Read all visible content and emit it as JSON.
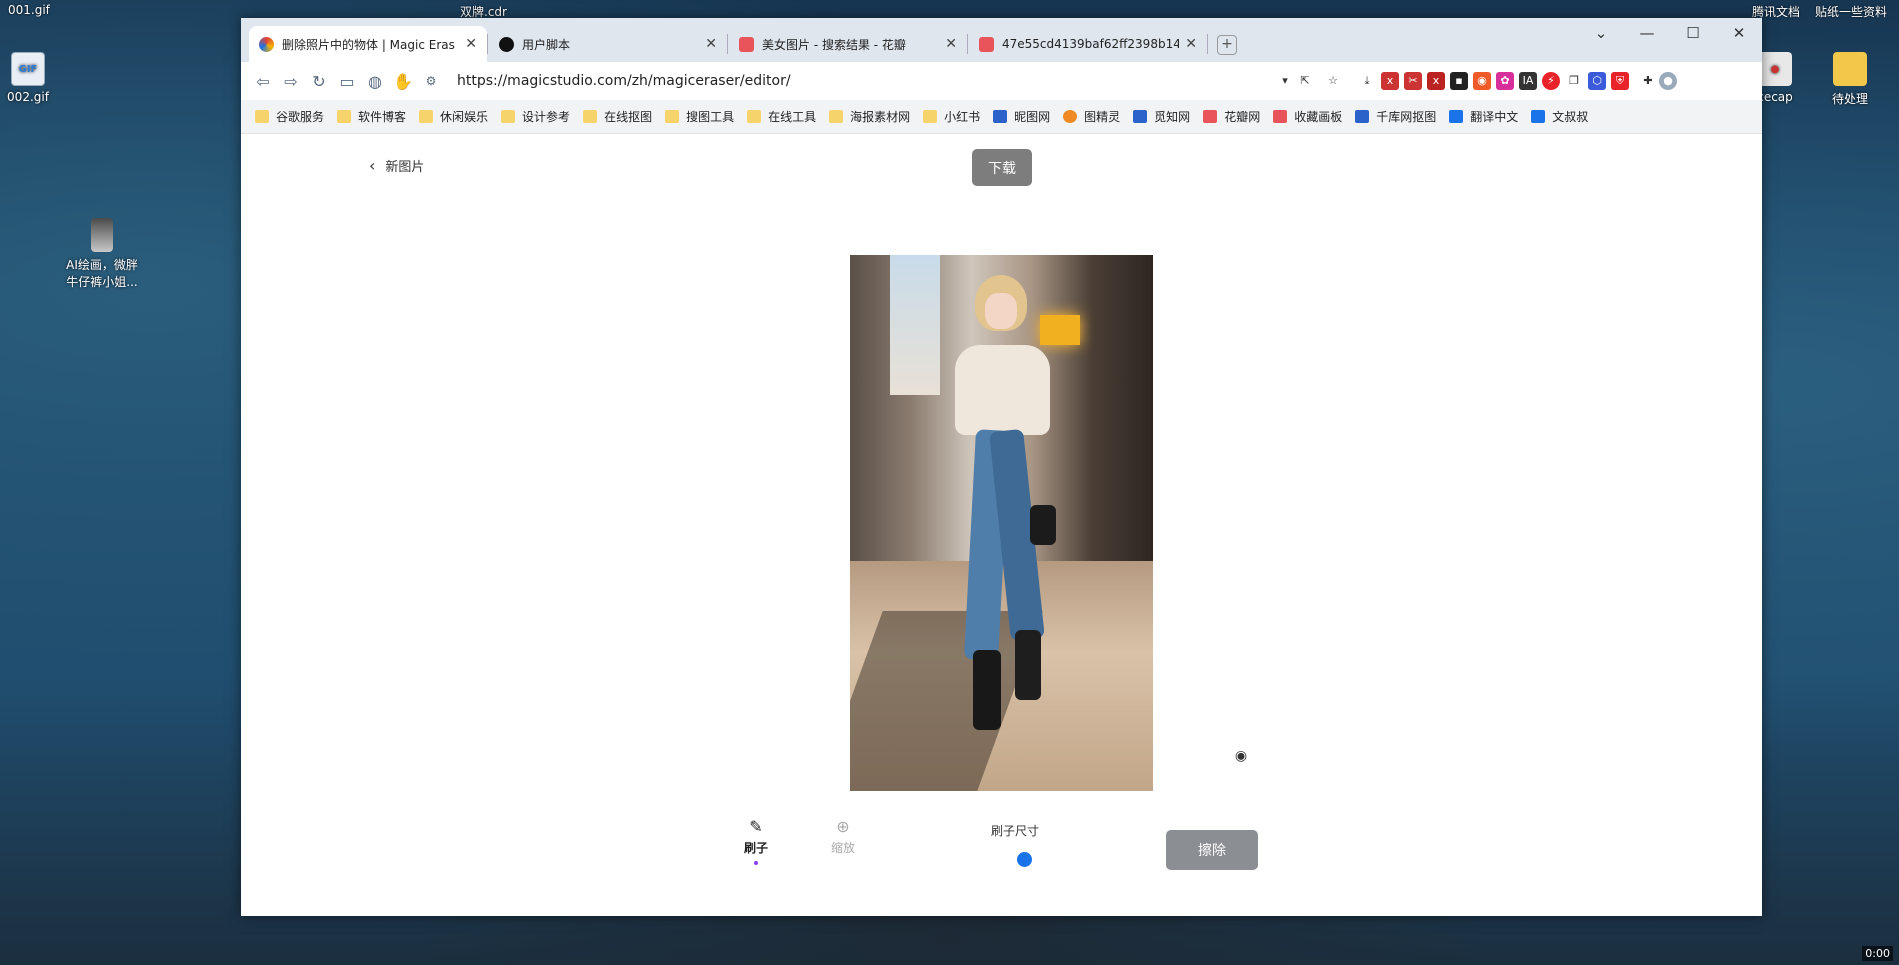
{
  "desktop": {
    "top_left_label": "001.gif",
    "top_center_label": "双牌.cdr",
    "top_right_labels": [
      "腾讯文档",
      "贴纸一些资料"
    ],
    "icons": [
      {
        "label": "002.gif",
        "icon": "gif-file-icon"
      },
      {
        "label": "AI绘画，微胖牛仔裤小姐...",
        "icon": "image-file-icon"
      },
      {
        "label": "cecap",
        "icon": "app-icon"
      },
      {
        "label": "待处理",
        "icon": "folder-icon"
      }
    ],
    "clock": "0:00"
  },
  "browser": {
    "tabs": [
      {
        "title": "删除照片中的物体 | Magic Eras",
        "active": true,
        "favicon_color": "#e0443a"
      },
      {
        "title": "用户脚本",
        "active": false,
        "favicon_color": "#111111"
      },
      {
        "title": "美女图片 - 搜索结果 - 花瓣",
        "active": false,
        "favicon_color": "#e8545a"
      },
      {
        "title": "47e55cd4139baf62ff2398b14",
        "active": false,
        "favicon_color": "#e8545a"
      }
    ],
    "url": "https://magicstudio.com/zh/magiceraser/editor/",
    "bookmarks": [
      {
        "label": "谷歌服务",
        "type": "folder"
      },
      {
        "label": "软件博客",
        "type": "folder"
      },
      {
        "label": "休闲娱乐",
        "type": "folder"
      },
      {
        "label": "设计参考",
        "type": "folder"
      },
      {
        "label": "在线抠图",
        "type": "folder"
      },
      {
        "label": "搜图工具",
        "type": "folder"
      },
      {
        "label": "在线工具",
        "type": "folder"
      },
      {
        "label": "海报素材网",
        "type": "folder"
      },
      {
        "label": "小红书",
        "type": "folder"
      },
      {
        "label": "昵图网",
        "type": "site",
        "color": "#2a62c9"
      },
      {
        "label": "图精灵",
        "type": "site",
        "color": "#f08a24"
      },
      {
        "label": "觅知网",
        "type": "site",
        "color": "#2a62c9"
      },
      {
        "label": "花瓣网",
        "type": "site",
        "color": "#e8545a"
      },
      {
        "label": "收藏画板",
        "type": "site",
        "color": "#e8545a"
      },
      {
        "label": "千库网抠图",
        "type": "site",
        "color": "#2a62c9"
      },
      {
        "label": "翻译中文",
        "type": "site",
        "color": "#1a73e8"
      },
      {
        "label": "文叔叔",
        "type": "site",
        "color": "#1a73e8"
      }
    ]
  },
  "editor": {
    "back_label": "新图片",
    "download_label": "下载",
    "tools": [
      {
        "label": "刷子",
        "icon": "magic-brush-icon",
        "active": true
      },
      {
        "label": "缩放",
        "icon": "zoom-icon",
        "active": false
      }
    ],
    "brush_size_label": "刷子尺寸",
    "erase_label": "擦除",
    "preview_icon": "eye-icon"
  }
}
